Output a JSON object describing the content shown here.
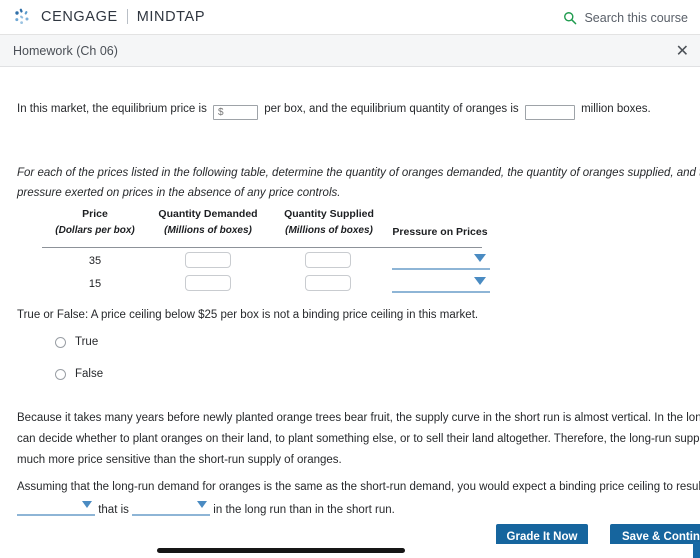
{
  "header": {
    "brand_primary": "CENGAGE",
    "brand_secondary": "MINDTAP",
    "search_label": "Search this course",
    "search_icon": "search-icon",
    "accent_green": "#1f9b4e"
  },
  "assignment_bar": {
    "title": "Homework (Ch 06)",
    "close_icon": "✕"
  },
  "intro": {
    "part1": "In this market, the equilibrium price is",
    "price_placeholder": "$",
    "price_value": "",
    "part2": "per box, and the equilibrium quantity of oranges is",
    "quantity_placeholder": "",
    "quantity_value": "",
    "part3": "million boxes."
  },
  "instructions": {
    "line1": "For each of the prices listed in the following table, determine the quantity of oranges demanded, the quantity of oranges supplied, and the dire",
    "line2": "pressure exerted on prices in the absence of any price controls."
  },
  "table": {
    "headers": [
      {
        "title": "Price",
        "subtitle": "(Dollars per box)"
      },
      {
        "title": "Quantity Demanded",
        "subtitle": "(Millions of boxes)"
      },
      {
        "title": "Quantity Supplied",
        "subtitle": "(Millions of boxes)"
      },
      {
        "title": "Pressure on Prices",
        "subtitle": ""
      }
    ],
    "rows": [
      {
        "price": "35",
        "quantity_demanded": "",
        "quantity_supplied": "",
        "pressure": ""
      },
      {
        "price": "15",
        "quantity_demanded": "",
        "quantity_supplied": "",
        "pressure": ""
      }
    ]
  },
  "true_false": {
    "question": "True or False: A price ceiling below $25 per box is not a binding price ceiling in this market.",
    "options": [
      {
        "label": "True",
        "selected": false
      },
      {
        "label": "False",
        "selected": false
      }
    ]
  },
  "explanation": {
    "line1": "Because it takes many years before newly planted orange trees bear fruit, the supply curve in the short run is almost vertical. In the long run,",
    "line2": "can decide whether to plant oranges on their land, to plant something else, or to sell their land altogether. Therefore, the long-run supply of or",
    "line3": "much more price sensitive than the short-run supply of oranges."
  },
  "final_question": {
    "line1": "Assuming that the long-run demand for oranges is the same as the short-run demand, you would expect a binding price ceiling to result in a",
    "dropdown1_value": "",
    "mid_text": "that is",
    "dropdown2_value": "",
    "tail_text": "in the long run than in the short run."
  },
  "footer": {
    "grade_label": "Grade It Now",
    "save_label": "Save & Contin",
    "button_color": "#16659e"
  }
}
